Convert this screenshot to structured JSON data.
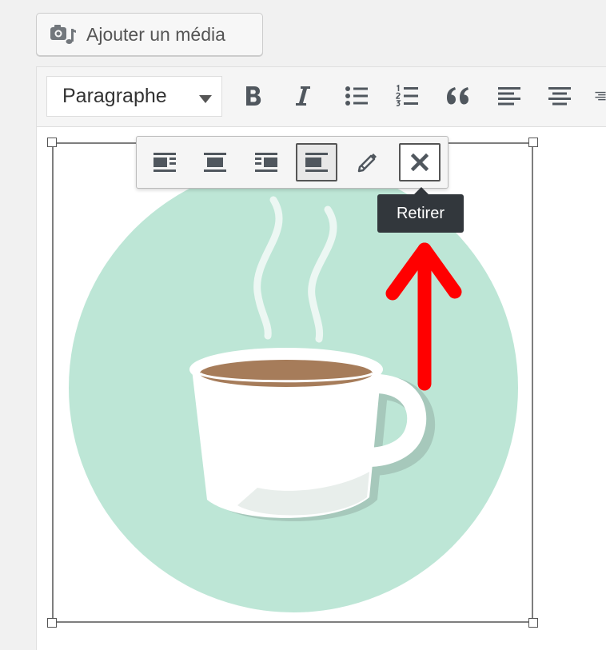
{
  "add_media": {
    "label": "Ajouter un média",
    "icon": "camera-music-icon"
  },
  "toolbar": {
    "format_select": {
      "value": "Paragraphe"
    },
    "buttons": [
      {
        "name": "bold",
        "icon": "bold-icon"
      },
      {
        "name": "italic",
        "icon": "italic-icon"
      },
      {
        "name": "bulleted-list",
        "icon": "bullet-list-icon"
      },
      {
        "name": "numbered-list",
        "icon": "numbered-list-icon"
      },
      {
        "name": "blockquote",
        "icon": "quote-icon"
      },
      {
        "name": "align-left",
        "icon": "align-left-icon"
      },
      {
        "name": "align-center",
        "icon": "align-center-icon"
      },
      {
        "name": "align-right",
        "icon": "align-right-icon"
      }
    ]
  },
  "image_toolbar": {
    "buttons": [
      {
        "name": "align-left",
        "icon": "image-align-left-icon",
        "active": false
      },
      {
        "name": "align-center",
        "icon": "image-align-center-icon",
        "active": false
      },
      {
        "name": "align-right",
        "icon": "image-align-right-icon",
        "active": false
      },
      {
        "name": "align-none",
        "icon": "image-align-none-icon",
        "active": true
      },
      {
        "name": "edit",
        "icon": "pencil-icon",
        "active": false
      },
      {
        "name": "remove",
        "icon": "close-icon",
        "active": false
      }
    ]
  },
  "tooltip": {
    "text": "Retirer"
  },
  "image": {
    "subject": "coffee cup with steam on mint circle"
  },
  "colors": {
    "circle": "#bde6d6",
    "coffee": "#a67c5a",
    "annotation_arrow": "#ff0000",
    "tooltip_bg": "#32373c"
  }
}
